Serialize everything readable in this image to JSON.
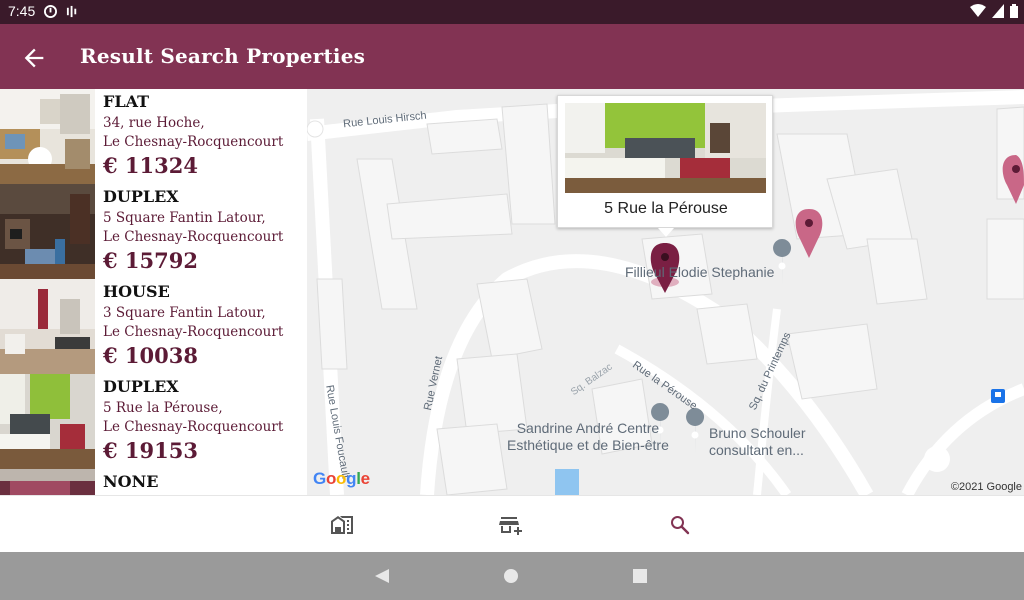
{
  "status_bar": {
    "time": "7:45"
  },
  "app_bar": {
    "title": "Result Search Properties"
  },
  "properties": [
    {
      "type": "FLAT",
      "address_line1": "34, rue Hoche,",
      "address_line2": "Le Chesnay-Rocquencourt",
      "price": "€ 11324"
    },
    {
      "type": "DUPLEX",
      "address_line1": "5 Square Fantin Latour,",
      "address_line2": "Le Chesnay-Rocquencourt",
      "price": "€ 15792"
    },
    {
      "type": "HOUSE",
      "address_line1": "3 Square Fantin Latour,",
      "address_line2": "Le Chesnay-Rocquencourt",
      "price": "€ 10038"
    },
    {
      "type": "DUPLEX",
      "address_line1": "5 Rue la Pérouse,",
      "address_line2": "Le Chesnay-Rocquencourt",
      "price": "€ 19153"
    },
    {
      "type": "NONE"
    }
  ],
  "map": {
    "info_window_label": "5 Rue la Pérouse",
    "streets": [
      "Rue Louis Hirsch",
      "Rue Louis Foucault",
      "Rue Vernet",
      "Rue la Pérouse",
      "Sq. Balzac",
      "Sq. du Printemps"
    ],
    "places": {
      "fillieul": "Fillieul Elodie Stephanie",
      "sandrine_1": "Sandrine André Centre",
      "sandrine_2": "Esthétique et de Bien-être",
      "bruno_1": "Bruno Schouler",
      "bruno_2": "consultant en..."
    },
    "google_logo": "Google",
    "copyright": "©2021 Google"
  },
  "bottom_nav": {
    "items": [
      "home-work-icon",
      "add-business-icon",
      "search-icon"
    ],
    "active": "search-icon"
  },
  "colors": {
    "app_bar": "#823353",
    "status_bar": "#3a1a2a",
    "accent_text": "#5c1b36",
    "marker_selected": "#7a1f43",
    "marker": "#c96787"
  }
}
